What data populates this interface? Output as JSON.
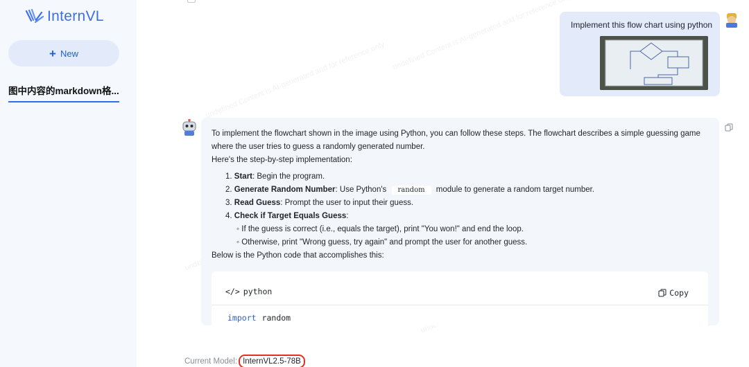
{
  "app": {
    "logo_text": "InternVL",
    "brand_color": "#3b6ee8"
  },
  "sidebar": {
    "new_label": "New",
    "conversations": [
      {
        "title": "图中内容的markdown格..."
      }
    ]
  },
  "user_message": {
    "text": "Implement this flow chart using python",
    "image_icon": "flowchart-photo"
  },
  "bot_message": {
    "intro": "To implement the flowchart shown in the image using Python, you can follow these steps. The flowchart describes a simple guessing game where the user tries to guess a randomly generated number.",
    "intro2": "Here's the step-by-step implementation:",
    "steps": [
      {
        "num": "1.",
        "title": "Start",
        "text": ": Begin the program."
      },
      {
        "num": "2.",
        "title": "Generate Random Number",
        "text_before": ": Use Python's",
        "code": "random",
        "text_after": "module to generate a random target number."
      },
      {
        "num": "3.",
        "title": "Read Guess",
        "text": ": Prompt the user to input their guess."
      },
      {
        "num": "4.",
        "title": "Check if Target Equals Guess",
        "text": ":"
      }
    ],
    "substeps": [
      "If the guess is correct (i.e., equals the target), print \"You won!\" and end the loop.",
      "Otherwise, print \"Wrong guess, try again\" and prompt the user for another guess."
    ],
    "below": "Below is the Python code that accomplishes this:",
    "code_block": {
      "language": "python",
      "copy_label": "Copy",
      "line_keyword": "import",
      "line_rest": "random"
    }
  },
  "footer": {
    "label": "Current Model:",
    "model": "InternVL2.5-78B",
    "highlight_color": "#e0301e"
  },
  "watermark": "undefined Content is AI-generated and for reference only"
}
